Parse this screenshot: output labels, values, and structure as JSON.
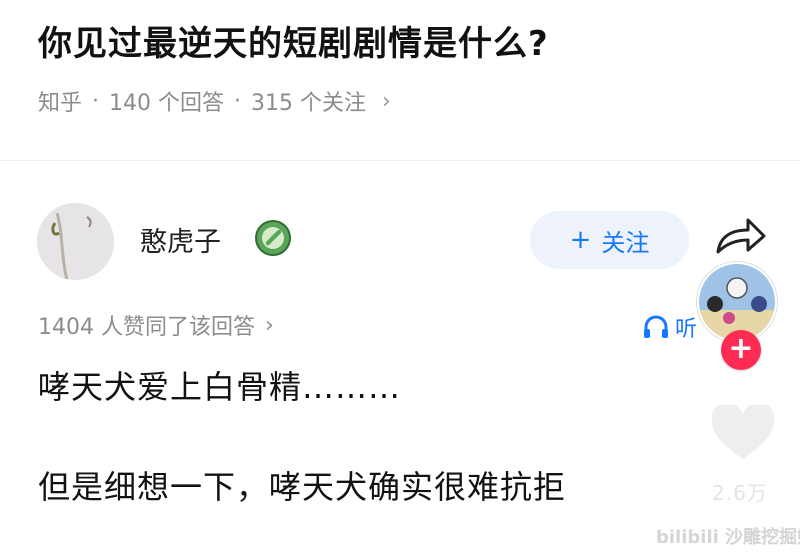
{
  "question": {
    "title": "你见过最逆天的短剧剧情是什么?",
    "source": "知乎",
    "answers": "140 个回答",
    "followers": "315 个关注",
    "separator": "·",
    "chevron": "›"
  },
  "answer": {
    "author": "憨虎子",
    "follow_label": "关注",
    "follow_plus": "+",
    "likes_text": "1404 人赞同了该回答",
    "listen_label": "听",
    "lines": [
      "哮天犬爱上白骨精………",
      "但是细想一下，哮天犬确实很难抗拒"
    ]
  },
  "overlay": {
    "creator_plus": "+",
    "like_count": "2.6万",
    "watermark": "bilibili 沙雕挖掘姬"
  },
  "colors": {
    "accent": "#1677ff",
    "follow_bg": "#eef3fb",
    "plus_red": "#fe2c55"
  },
  "icons": [
    "badge-icon",
    "share-icon",
    "headphones-icon",
    "heart-icon",
    "plus-icon"
  ]
}
